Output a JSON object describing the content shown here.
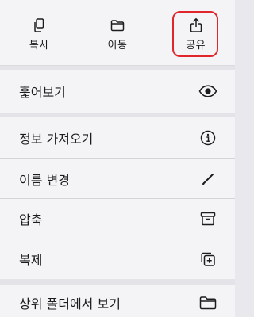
{
  "top_actions": [
    {
      "label": "복사",
      "icon": "copy-icon"
    },
    {
      "label": "이동",
      "icon": "folder-icon"
    },
    {
      "label": "공유",
      "icon": "share-icon"
    }
  ],
  "menu": {
    "preview": {
      "label": "훑어보기",
      "icon": "eye-icon"
    },
    "get_info": {
      "label": "정보 가져오기",
      "icon": "info-icon"
    },
    "rename": {
      "label": "이름 변경",
      "icon": "pencil-icon"
    },
    "compress": {
      "label": "압축",
      "icon": "archive-icon"
    },
    "duplicate": {
      "label": "복제",
      "icon": "duplicate-icon"
    },
    "show_enclosing": {
      "label": "상위 폴더에서 보기",
      "icon": "folder-icon"
    }
  },
  "highlight_color": "#e0252b"
}
